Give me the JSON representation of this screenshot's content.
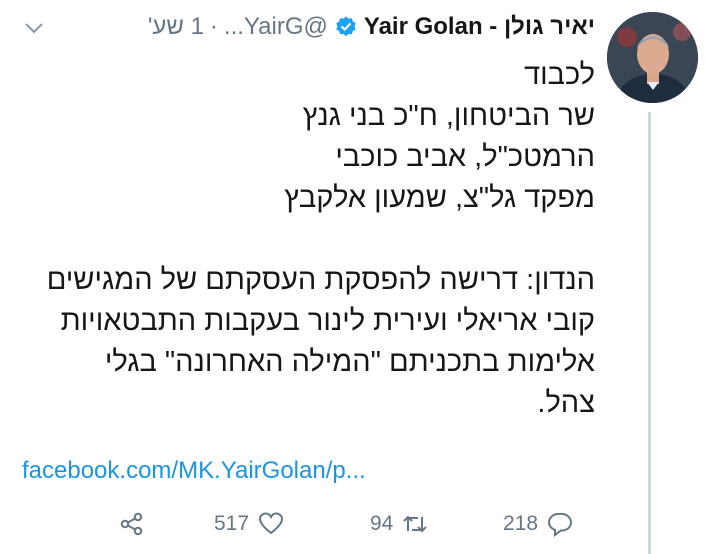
{
  "tweet": {
    "display_name": "יאיר גולן - Yair Golan",
    "handle": "@YairG...",
    "separator": "·",
    "time": "1 שע'",
    "lines": [
      "לכבוד",
      "שר הביטחון, ח\"כ בני גנץ",
      "הרמטכ\"ל, אביב כוכבי",
      "מפקד גל\"צ, שמעון אלקבץ",
      "",
      "הנדון: דרישה להפסקת העסקתם של המגישים",
      "קובי אריאלי ועירית לינור בעקבות התבטאויות",
      "אלימות בתכניתם \"המילה האחרונה\" בגלי",
      "צהל."
    ],
    "link": "facebook.com/MK.YairGolan/p..."
  },
  "actions": {
    "reply_count": "218",
    "retweet_count": "94",
    "like_count": "517"
  },
  "icons": {
    "verified": "verified-badge-icon",
    "more": "chevron-down-icon",
    "reply": "reply-icon",
    "retweet": "retweet-icon",
    "like": "heart-icon",
    "share": "share-icon"
  },
  "colors": {
    "link": "#1b95e0",
    "muted": "#657786",
    "verified": "#1da1f2"
  }
}
